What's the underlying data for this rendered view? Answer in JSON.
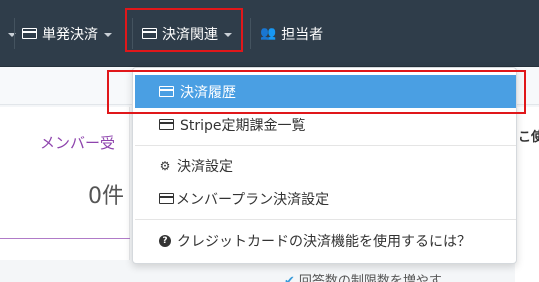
{
  "navbar": {
    "items": [
      {
        "label": "単発決済",
        "icon": "card-icon"
      },
      {
        "label": "決済関連",
        "icon": "card-icon"
      },
      {
        "label": "担当者",
        "icon": "users-icon"
      }
    ]
  },
  "dropdown": {
    "items": [
      {
        "label": "決済履歴",
        "icon": "card-icon",
        "active": true
      },
      {
        "label": "Stripe定期課金一覧",
        "icon": "card-icon"
      },
      {
        "label": "決済設定",
        "icon": "gear-icon"
      },
      {
        "label": "メンバープラン決済設定",
        "icon": "card-icon"
      },
      {
        "label": "クレジットカードの決済機能を使用するには？",
        "icon": "question-circle-icon"
      }
    ]
  },
  "page": {
    "member_label": "メンバー受",
    "count_label": "0件",
    "right_label": "こ使",
    "bottom_hint": "回答数の制限数を増やす"
  },
  "colors": {
    "navbar_bg": "#2f3d4a",
    "active_item_bg": "#4a9fe3",
    "highlight_border": "#e0171a",
    "member_text": "#8e44ad"
  }
}
